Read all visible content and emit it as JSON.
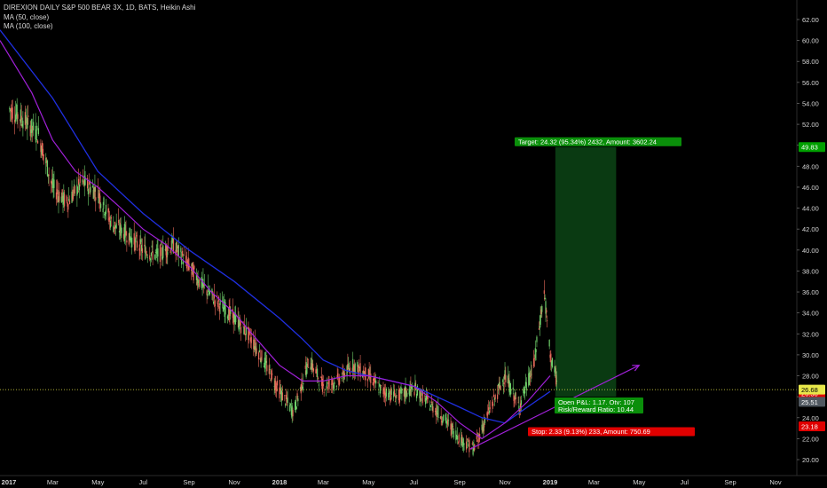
{
  "chart_data": {
    "type": "line",
    "title": "DIREXION DAILY S&P 500 BEAR 3X, 1D, BATS, Heikin Ashi",
    "indicators": [
      "MA (50, close)",
      "MA (100, close)"
    ],
    "x_ticks": [
      "2017",
      "Mar",
      "May",
      "Jul",
      "Sep",
      "Nov",
      "2018",
      "Mar",
      "May",
      "Jul",
      "Sep",
      "Nov",
      "2019",
      "Mar",
      "May",
      "Jul",
      "Sep",
      "Nov"
    ],
    "y_ticks": [
      "20.00",
      "22.00",
      "24.00",
      "26.00",
      "28.00",
      "30.00",
      "32.00",
      "34.00",
      "36.00",
      "38.00",
      "40.00",
      "42.00",
      "44.00",
      "46.00",
      "48.00",
      "50.00",
      "52.00",
      "54.00",
      "56.00",
      "58.00",
      "60.00",
      "62.00"
    ],
    "ylim": [
      19.2,
      63.0
    ],
    "series": [
      {
        "name": "price",
        "x": [
          "2017-01-01",
          "2017-01-20",
          "2017-02-10",
          "2017-03-01",
          "2017-03-20",
          "2017-04-10",
          "2017-05-01",
          "2017-05-20",
          "2017-06-10",
          "2017-07-01",
          "2017-07-20",
          "2017-08-10",
          "2017-09-01",
          "2017-09-20",
          "2017-10-10",
          "2017-11-01",
          "2017-11-20",
          "2017-12-10",
          "2018-01-01",
          "2018-01-20",
          "2018-02-10",
          "2018-03-01",
          "2018-03-20",
          "2018-04-10",
          "2018-05-01",
          "2018-05-20",
          "2018-06-10",
          "2018-07-01",
          "2018-07-20",
          "2018-08-10",
          "2018-09-01",
          "2018-09-20",
          "2018-10-10",
          "2018-11-01",
          "2018-11-20",
          "2018-12-10",
          "2018-12-24",
          "2019-01-01",
          "2019-01-10"
        ],
        "values": [
          53.5,
          52.5,
          51.0,
          46.0,
          44.5,
          46.5,
          45.5,
          42.5,
          41.5,
          40.0,
          39.5,
          40.5,
          38.5,
          36.5,
          35.0,
          33.5,
          32.0,
          29.5,
          26.5,
          24.5,
          29.5,
          27.0,
          27.5,
          29.0,
          28.0,
          26.5,
          26.0,
          26.8,
          25.5,
          24.0,
          22.0,
          21.0,
          24.5,
          28.0,
          25.0,
          29.0,
          36.0,
          30.0,
          27.5
        ]
      },
      {
        "name": "MA (50, close)",
        "x": [
          "2016-12-20",
          "2017-02-01",
          "2017-03-01",
          "2017-04-01",
          "2017-05-01",
          "2017-06-01",
          "2017-07-01",
          "2017-08-01",
          "2017-09-01",
          "2017-10-01",
          "2017-11-01",
          "2017-12-01",
          "2018-01-01",
          "2018-02-01",
          "2018-03-01",
          "2018-04-01",
          "2018-05-01",
          "2018-06-01",
          "2018-07-01",
          "2018-08-01",
          "2018-09-01",
          "2018-10-01",
          "2018-11-01",
          "2018-12-01",
          "2019-01-01"
        ],
        "values": [
          60.0,
          55.0,
          50.5,
          47.5,
          46.0,
          44.0,
          42.0,
          40.5,
          38.5,
          36.0,
          34.0,
          31.5,
          29.0,
          27.5,
          27.5,
          28.0,
          28.0,
          27.5,
          27.0,
          25.5,
          23.5,
          22.0,
          23.5,
          25.5,
          28.0
        ]
      },
      {
        "name": "MA (100, close)",
        "x": [
          "2016-12-20",
          "2017-03-01",
          "2017-05-01",
          "2017-07-01",
          "2017-09-01",
          "2017-11-01",
          "2018-01-01",
          "2018-02-01",
          "2018-03-01",
          "2018-04-01",
          "2018-05-01",
          "2018-06-01",
          "2018-07-01",
          "2018-08-01",
          "2018-09-01",
          "2018-10-01",
          "2018-11-01",
          "2018-12-01",
          "2019-01-01"
        ],
        "values": [
          61.0,
          54.5,
          47.5,
          43.5,
          40.0,
          37.0,
          33.5,
          31.5,
          29.5,
          28.5,
          28.0,
          27.5,
          27.0,
          26.0,
          25.0,
          24.0,
          23.5,
          25.0,
          26.5
        ]
      }
    ],
    "trendline": {
      "x": [
        "2018-09-15",
        "2019-05-01"
      ],
      "values": [
        21.0,
        29.0
      ]
    },
    "current_price": {
      "value": 26.68,
      "label": "26.68",
      "color": "#e8e84a"
    },
    "axis_badges": [
      {
        "value": 49.83,
        "label": "49.83",
        "color": "#00a000"
      },
      {
        "value": 26.3,
        "label": "26.30",
        "color": "#e00000"
      },
      {
        "value": 25.51,
        "label": "25.51",
        "color": "#505860"
      },
      {
        "value": 23.18,
        "label": "23.18",
        "color": "#e00000"
      }
    ],
    "position": {
      "start_date": "2019-01-08",
      "end_date": "2019-03-31",
      "entry": 26.0,
      "target": 49.83,
      "stop": 23.18,
      "target_label": "Target: 24.32 (95.34%) 2432, Amount: 3602.24",
      "stop_label": "Stop: 2.33 (9.13%) 233, Amount: 750.69",
      "pnl_label": "Open P&L: 1.17, Qty: 107",
      "ratio_label": "Risk/Reward Ratio: 10.44"
    },
    "colors": {
      "background": "#000000",
      "ma50": "#a020d8",
      "ma100": "#1f2fe0",
      "up_candle": "#6fcf6a",
      "down_candle": "#e86a5a",
      "trendline": "#a020d8",
      "profit_zone": "#0a3a12",
      "target_label_bg": "#0a8f0a",
      "stop_label_bg": "#e00000",
      "axis_text": "#d6d6d6"
    }
  }
}
